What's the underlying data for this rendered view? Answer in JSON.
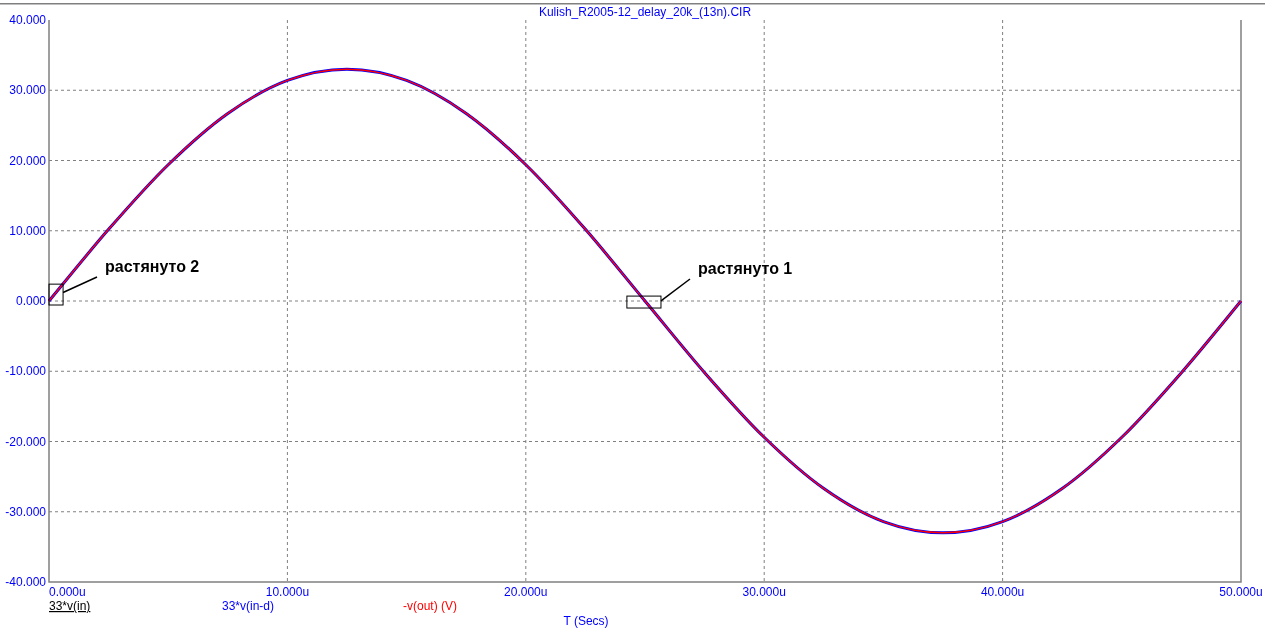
{
  "plot": {
    "chart_data": {
      "type": "line",
      "title": "Kulish_R2005-12_delay_20k_(13n).CIR",
      "xlabel": "T (Secs)",
      "grid": true,
      "x": [
        0,
        2.5,
        5,
        7.5,
        10,
        12.5,
        15,
        17.5,
        20,
        22.5,
        25,
        27.5,
        30,
        32.5,
        35,
        37.5,
        40,
        42.5,
        45,
        47.5,
        50
      ],
      "series": [
        {
          "color": "#0000ff",
          "values": [
            0,
            10.2,
            19.4,
            26.7,
            31.4,
            33,
            31.4,
            26.7,
            19.4,
            10.2,
            0,
            -10.2,
            -19.4,
            -26.7,
            -31.4,
            -33,
            -31.4,
            -26.7,
            -19.4,
            -10.2,
            0
          ]
        },
        {
          "color": "#ff0000",
          "values": [
            0,
            10.2,
            19.4,
            26.7,
            31.4,
            33,
            31.4,
            26.7,
            19.4,
            10.2,
            0,
            -10.2,
            -19.4,
            -26.7,
            -31.4,
            -33,
            -31.4,
            -26.7,
            -19.4,
            -10.2,
            0
          ]
        }
      ],
      "xlim": [
        0,
        50
      ],
      "ylim": [
        -40,
        40
      ],
      "xticks": [
        {
          "value": 0,
          "label": "0.000u"
        },
        {
          "value": 10,
          "label": "10.000u"
        },
        {
          "value": 20,
          "label": "20.000u"
        },
        {
          "value": 30,
          "label": "30.000u"
        },
        {
          "value": 40,
          "label": "40.000u"
        },
        {
          "value": 50,
          "label": "50.000u"
        }
      ],
      "yticks": [
        {
          "value": 40,
          "label": "40.000"
        },
        {
          "value": 30,
          "label": "30.000"
        },
        {
          "value": 20,
          "label": "20.000"
        },
        {
          "value": 10,
          "label": "10.000"
        },
        {
          "value": 0,
          "label": "0.000"
        },
        {
          "value": -10,
          "label": "-10.000"
        },
        {
          "value": -20,
          "label": "-20.000"
        },
        {
          "value": -30,
          "label": "-30.000"
        },
        {
          "value": -40,
          "label": "-40.000"
        }
      ],
      "annotations": [
        "растянуто 2",
        "растянуто 1"
      ]
    },
    "legend": [
      {
        "label": "33*v(in)",
        "color": "#000000",
        "selected": true
      },
      {
        "label": "33*v(in-d)",
        "color": "#0000ff",
        "selected": false
      },
      {
        "label": "-v(out) (V)",
        "color": "#ff0000",
        "selected": false
      }
    ]
  }
}
